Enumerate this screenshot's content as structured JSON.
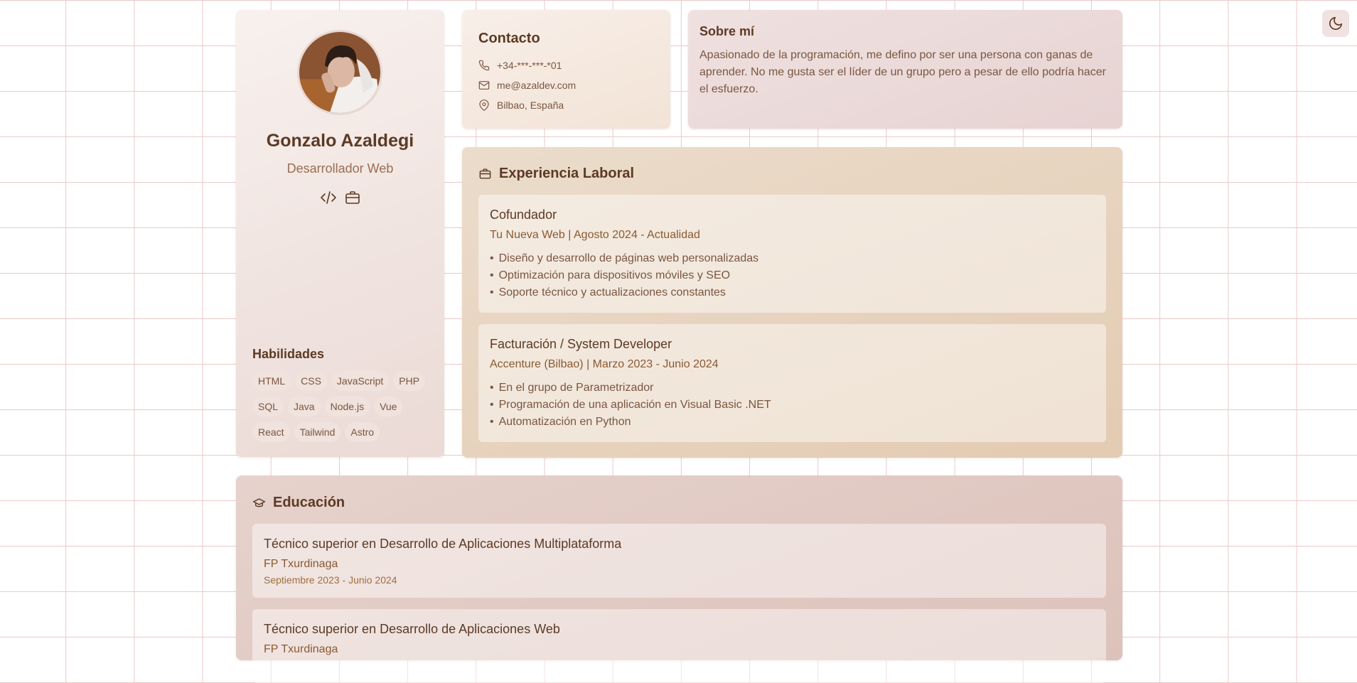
{
  "profile": {
    "name": "Gonzalo Azaldegi",
    "role": "Desarrollador Web",
    "icons": [
      "code-icon",
      "briefcase-icon"
    ],
    "skills_title": "Habilidades",
    "skills": [
      "HTML",
      "CSS",
      "JavaScript",
      "PHP",
      "SQL",
      "Java",
      "Node.js",
      "Vue",
      "React",
      "Tailwind",
      "Astro"
    ]
  },
  "contact": {
    "title": "Contacto",
    "phone": "+34-***-***-*01",
    "email": "me@azaldev.com",
    "location": "Bilbao, España"
  },
  "about": {
    "title": "Sobre mí",
    "text": "Apasionado de la programación, me defino por ser una persona con ganas de aprender. No me gusta ser el líder de un grupo pero a pesar de ello podría hacer el esfuerzo."
  },
  "experience": {
    "title": "Experiencia Laboral",
    "items": [
      {
        "title": "Cofundador",
        "subtitle": "Tu Nueva Web | Agosto 2024 - Actualidad",
        "bullets": [
          "Diseño y desarrollo de páginas web personalizadas",
          "Optimización para dispositivos móviles y SEO",
          "Soporte técnico y actualizaciones constantes"
        ]
      },
      {
        "title": "Facturación / System Developer",
        "subtitle": "Accenture (Bilbao) | Marzo 2023 - Junio 2024",
        "bullets": [
          "En el grupo de Parametrizador",
          "Programación de una aplicación en Visual Basic .NET",
          "Automatización en Python"
        ]
      }
    ]
  },
  "education": {
    "title": "Educación",
    "items": [
      {
        "title": "Técnico superior en Desarrollo de Aplicaciones Multiplataforma",
        "school": "FP Txurdinaga",
        "date": "Septiembre 2023 - Junio 2024"
      },
      {
        "title": "Técnico superior en Desarrollo de Aplicaciones Web",
        "school": "FP Txurdinaga",
        "date": ""
      }
    ]
  },
  "theme_toggle": {
    "icon": "moon-icon"
  },
  "colors": {
    "accent": "#5c3a24",
    "muted": "#7a5640",
    "grid": "#ebc9c9"
  }
}
